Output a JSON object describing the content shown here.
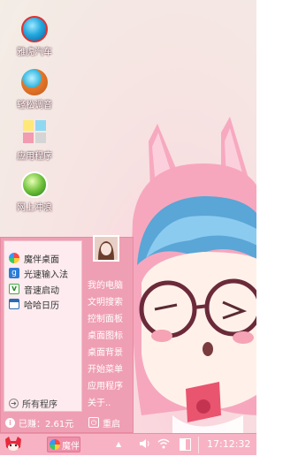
{
  "desktop": {
    "icons": [
      {
        "label": "雅虎汽车",
        "icon": "blue-ball-icon"
      },
      {
        "label": "轻松调音",
        "icon": "orange-ball-icon"
      },
      {
        "label": "应用程序",
        "icon": "apps-grid-icon"
      },
      {
        "label": "网上冲浪",
        "icon": "browser-e-icon"
      }
    ]
  },
  "start_menu": {
    "programs": [
      {
        "label": "魔伴桌面",
        "icon": "pinwheel-icon"
      },
      {
        "label": "光速输入法",
        "icon": "g-keyboard-icon"
      },
      {
        "label": "音速启动",
        "icon": "v-launcher-icon"
      },
      {
        "label": "哈哈日历",
        "icon": "calendar-icon"
      }
    ],
    "all_programs_label": "所有程序",
    "right_items": [
      "我的电脑",
      "文明搜索",
      "控制面板",
      "桌面图标",
      "桌面背景",
      "开始菜单",
      "应用程序",
      "关于.."
    ],
    "status_text": "已赚：2.61元",
    "restart_label": "重启"
  },
  "taskbar": {
    "task_label": "魔伴",
    "tray_arrow": "▲",
    "clock": "17:12:32"
  },
  "colors": {
    "menu_pink": "#ef9fb3",
    "taskbar_pink": "#f7b3c4",
    "menu_panel": "#fdebef"
  }
}
